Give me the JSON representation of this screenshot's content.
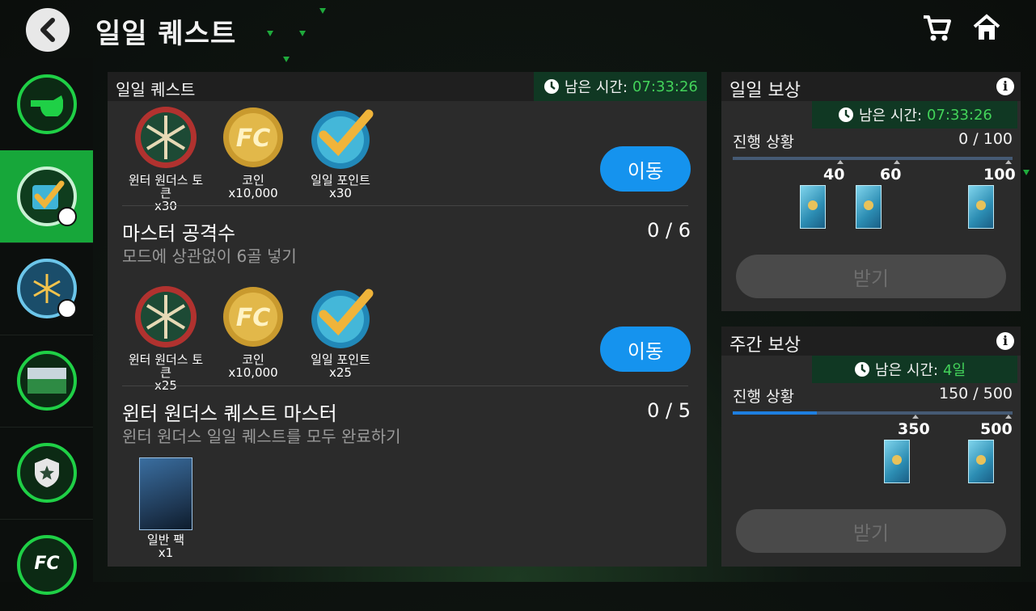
{
  "header": {
    "title": "일일 퀘스트"
  },
  "quest_panel": {
    "title": "일일 퀘스트",
    "timer_label": "남은 시간:",
    "timer_value": "07:33:26",
    "quests": [
      {
        "rewards": [
          {
            "name": "윈터 원더스 토큰",
            "amount": "x30",
            "icon": "snowflake-token-icon"
          },
          {
            "name": "코인",
            "amount": "x10,000",
            "icon": "coin-icon"
          },
          {
            "name": "일일 포인트",
            "amount": "x30",
            "icon": "daily-point-check-icon"
          }
        ],
        "button": "이동"
      },
      {
        "name": "마스터 공격수",
        "desc": "모드에 상관없이 6골 넣기",
        "progress": "0 / 6",
        "rewards": [
          {
            "name": "윈터 원더스 토큰",
            "amount": "x25",
            "icon": "snowflake-token-icon"
          },
          {
            "name": "코인",
            "amount": "x10,000",
            "icon": "coin-icon"
          },
          {
            "name": "일일 포인트",
            "amount": "x25",
            "icon": "daily-point-check-icon"
          }
        ],
        "button": "이동"
      },
      {
        "name": "윈터 원더스 퀘스트 마스터",
        "desc": "윈터 원더스 일일 퀘스트를 모두 완료하기",
        "progress": "0 / 5",
        "rewards": [
          {
            "name": "일반 팩",
            "amount": "x1",
            "icon": "pack-card-icon"
          }
        ]
      }
    ]
  },
  "daily_reward": {
    "title": "일일 보상",
    "timer_label": "남은 시간:",
    "timer_value": "07:33:26",
    "progress_label": "진행 상황",
    "progress_text": "0 / 100",
    "progress_fraction": 0,
    "milestones": [
      "40",
      "60",
      "100"
    ],
    "claim": "받기"
  },
  "weekly_reward": {
    "title": "주간 보상",
    "timer_label": "남은 시간:",
    "timer_value": "4일",
    "progress_label": "진행 상황",
    "progress_text": "150 / 500",
    "progress_fraction": 0.3,
    "milestones": [
      "350",
      "500"
    ],
    "claim": "받기"
  },
  "sidebar": {
    "items": [
      {
        "icon": "whistle-icon",
        "active": false
      },
      {
        "icon": "daily-check-icon",
        "active": true
      },
      {
        "icon": "snowflake-icon",
        "active": false
      },
      {
        "icon": "stadium-icon",
        "active": false
      },
      {
        "icon": "shield-star-icon",
        "active": false
      },
      {
        "icon": "fc-mobile-logo",
        "active": false
      }
    ]
  },
  "colors": {
    "accent_green": "#17a73a",
    "button_blue": "#1593ee",
    "timer_green": "#43d35a"
  }
}
